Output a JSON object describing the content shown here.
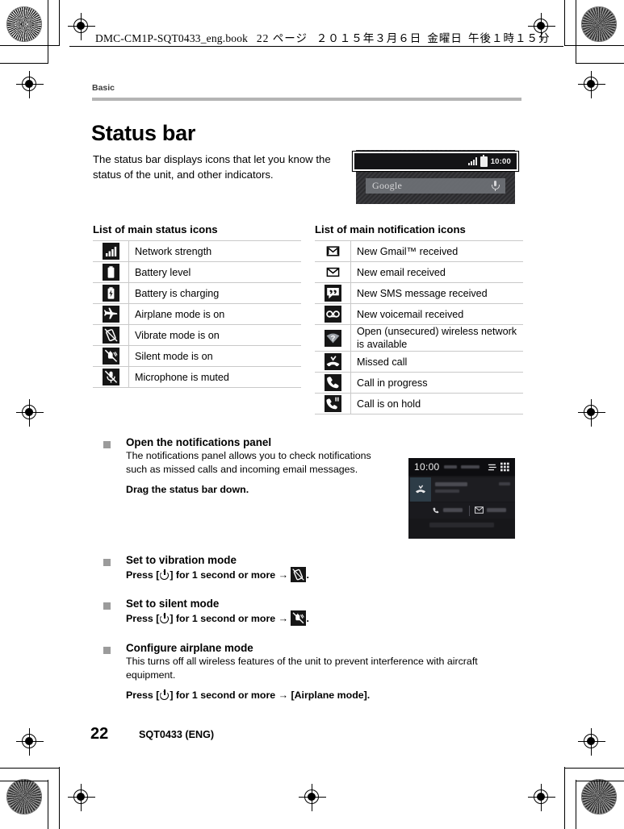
{
  "imposition": {
    "book_line": "DMC-CM1P-SQT0433_eng.book",
    "page_label": "22 ページ",
    "date": "２０１５年３月６日",
    "weekday": "金曜日",
    "time": "午後１時１５分"
  },
  "running_head": "Basic",
  "title": "Status bar",
  "intro": "The status bar displays icons that let you know the status of the unit, and other indicators.",
  "device_art": {
    "status_time": "10:00",
    "search_placeholder": "Google"
  },
  "status_table": {
    "title": "List of main status icons",
    "rows": [
      {
        "icon": "signal-bars-icon",
        "label": "Network strength"
      },
      {
        "icon": "battery-icon",
        "label": "Battery level"
      },
      {
        "icon": "battery-charging-icon",
        "label": "Battery is charging"
      },
      {
        "icon": "airplane-icon",
        "label": "Airplane mode is on"
      },
      {
        "icon": "vibrate-icon",
        "label": "Vibrate mode is on"
      },
      {
        "icon": "silent-bell-off-icon",
        "label": "Silent mode is on"
      },
      {
        "icon": "microphone-muted-icon",
        "label": "Microphone is muted"
      }
    ]
  },
  "notification_table": {
    "title": "List of main notification icons",
    "rows": [
      {
        "icon": "gmail-icon",
        "label": "New Gmail™ received"
      },
      {
        "icon": "email-icon",
        "label": "New email received"
      },
      {
        "icon": "sms-icon",
        "label": "New SMS message received"
      },
      {
        "icon": "voicemail-icon",
        "label": "New voicemail received"
      },
      {
        "icon": "wifi-question-icon",
        "label": "Open (unsecured) wireless network is available"
      },
      {
        "icon": "missed-call-icon",
        "label": "Missed call"
      },
      {
        "icon": "call-in-progress-icon",
        "label": "Call in progress"
      },
      {
        "icon": "call-on-hold-icon",
        "label": "Call is on hold"
      }
    ]
  },
  "sections": {
    "notifications_panel": {
      "title": "Open the notifications panel",
      "body": "The notifications panel allows you to check notifications such as missed calls and incoming email messages.",
      "instruction": "Drag the status bar down."
    },
    "vibration": {
      "title": "Set to vibration mode",
      "press_prefix": "Press [",
      "press_suffix": "] for 1 second or more",
      "arrow": "→",
      "trailing": "."
    },
    "silent": {
      "title": "Set to silent mode",
      "press_prefix": "Press [",
      "press_suffix": "] for 1 second or more",
      "arrow": "→",
      "trailing": "."
    },
    "airplane": {
      "title": "Configure airplane mode",
      "body": "This turns off all wireless features of the unit to prevent interference with aircraft equipment.",
      "press_prefix": "Press [",
      "press_suffix": "] for 1 second or more",
      "arrow": "→",
      "target": "[Airplane mode]."
    }
  },
  "notif_panel_art": {
    "time": "10:00"
  },
  "footer": {
    "page_number": "22",
    "code": "SQT0433 (ENG)"
  }
}
